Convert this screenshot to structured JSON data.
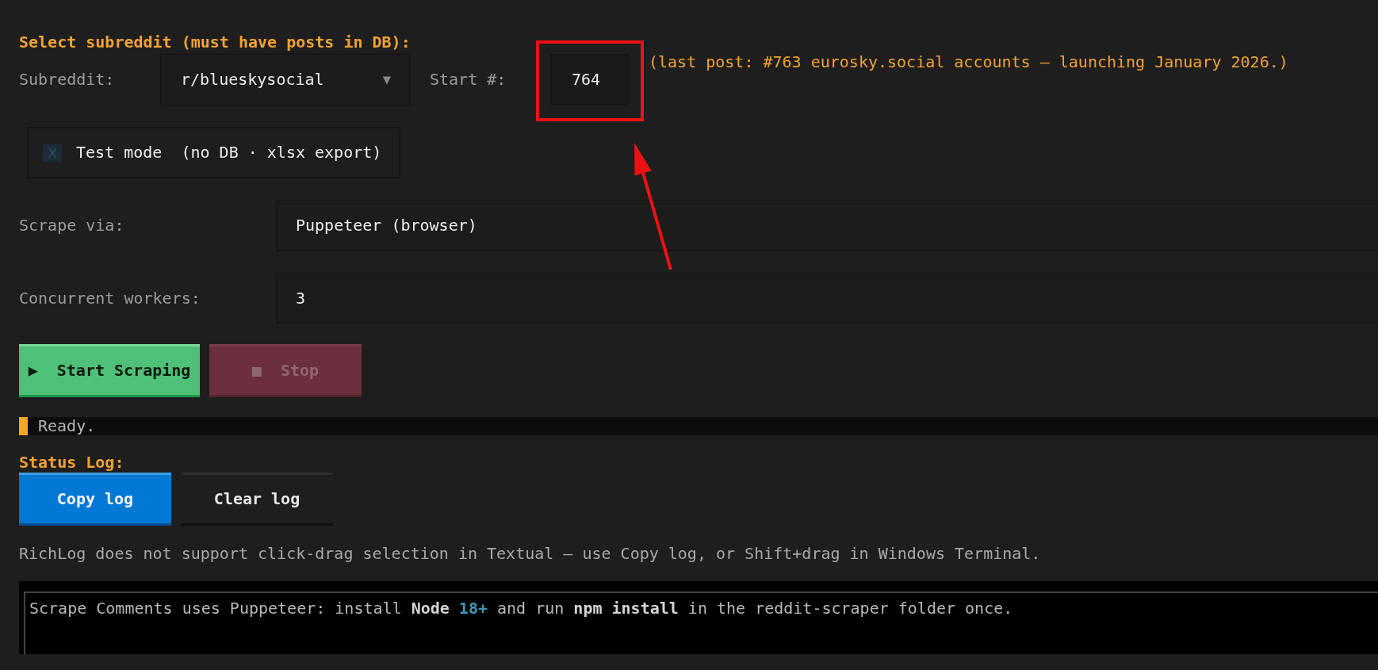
{
  "form": {
    "heading": "Select subreddit (must have posts in DB):",
    "subreddit": {
      "label": "Subreddit:",
      "value": "r/blueskysocial",
      "arrow": "▼"
    },
    "start_number": {
      "label": "Start #:",
      "value": "764",
      "highlighted": true
    },
    "last_post_note": "(last post: #763 eurosky.social accounts – launching January 2026.)",
    "test_mode": {
      "label": "Test mode  (no DB · xlsx export)",
      "checked": false
    },
    "scrape_via": {
      "label": "Scrape via:",
      "value": "Puppeteer (browser)"
    },
    "concurrent_workers": {
      "label": "Concurrent workers:",
      "value": "3"
    }
  },
  "actions": [
    {
      "label": "▶  Start Scraping",
      "kind": "success",
      "disabled": false
    },
    {
      "label": "■  Stop",
      "kind": "error",
      "disabled": true
    }
  ],
  "status_bar": {
    "text": "Ready."
  },
  "status_log": {
    "heading": "Status Log:",
    "buttons": [
      {
        "label": "Copy log",
        "kind": "primary",
        "disabled": false
      },
      {
        "label": "Clear log",
        "kind": "default",
        "disabled": false
      }
    ],
    "hint": "RichLog does not support click-drag selection in Textual — use Copy log, or Shift+drag in Windows Terminal.",
    "lines": [
      {
        "segments": [
          {
            "text": "Scrape Comments uses Puppeteer: install ",
            "kind": "plain"
          },
          {
            "text": "Node ",
            "kind": "bold"
          },
          {
            "text": "18+",
            "kind": "number"
          },
          {
            "text": " and run ",
            "kind": "plain"
          },
          {
            "text": "npm install",
            "kind": "bold"
          },
          {
            "text": " in the reddit-scraper folder once.",
            "kind": "plain"
          }
        ]
      }
    ]
  }
}
